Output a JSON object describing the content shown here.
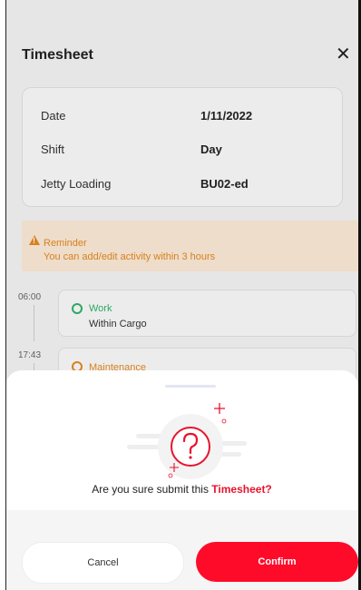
{
  "header": {
    "title": "Timesheet",
    "close_glyph": "✕"
  },
  "info": [
    {
      "label": "Date",
      "value": "1/11/2022"
    },
    {
      "label": "Shift",
      "value": "Day"
    },
    {
      "label": "Jetty Loading",
      "value": "BU02-ed"
    }
  ],
  "reminder": {
    "title": "Reminder",
    "text": "You can add/edit activity within 3 hours"
  },
  "timeline": [
    {
      "time": "06:00",
      "type": "Work",
      "name": "Within Cargo",
      "color": "#2fb36b"
    },
    {
      "time": "17:43",
      "type": "Maintenance",
      "name": "",
      "color": "#e58a21"
    }
  ],
  "dialog": {
    "question_prefix": "Are you sure submit this ",
    "question_accent": "Timesheet?",
    "question_icon": "question-icon",
    "cancel_label": "Cancel",
    "confirm_label": "Confirm",
    "accent_color": "#ff0b2a"
  }
}
